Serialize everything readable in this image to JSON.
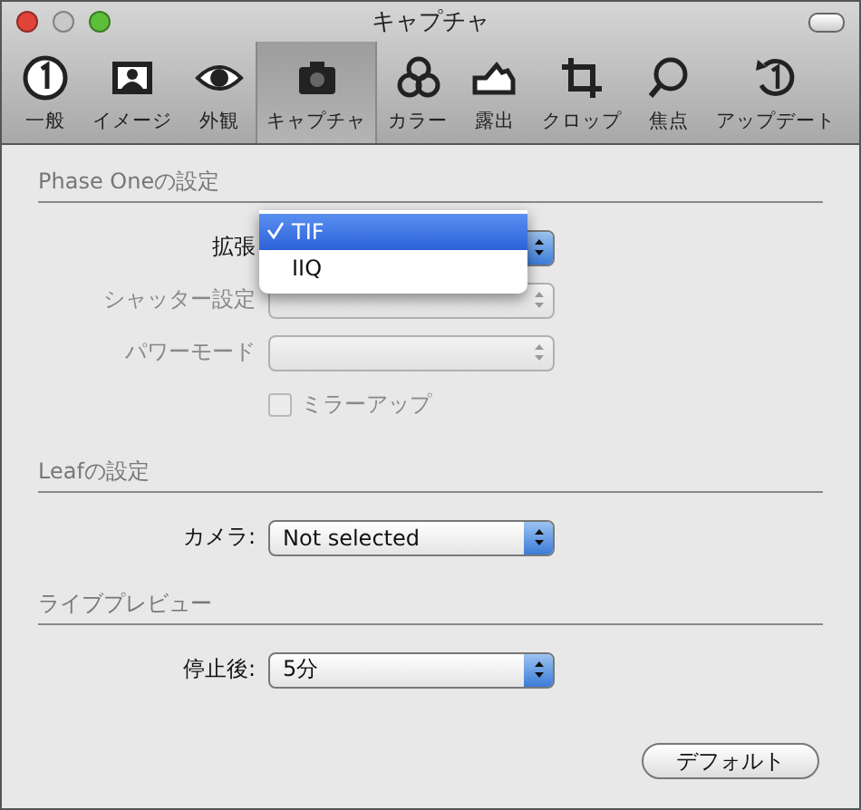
{
  "window": {
    "title": "キャプチャ"
  },
  "toolbar": [
    {
      "label": "一般",
      "selected": false
    },
    {
      "label": "イメージ",
      "selected": false
    },
    {
      "label": "外観",
      "selected": false
    },
    {
      "label": "キャプチャ",
      "selected": true
    },
    {
      "label": "カラー",
      "selected": false
    },
    {
      "label": "露出",
      "selected": false
    },
    {
      "label": "クロップ",
      "selected": false
    },
    {
      "label": "焦点",
      "selected": false
    },
    {
      "label": "アップデート",
      "selected": false
    }
  ],
  "sections": [
    {
      "title": "Phase Oneの設定",
      "rows": [
        {
          "kind": "popup",
          "label": "拡張",
          "disabled": false,
          "open": true,
          "menu": [
            {
              "label": "TIF",
              "selected": true
            },
            {
              "label": "IIQ",
              "selected": false
            }
          ]
        },
        {
          "kind": "popup",
          "label": "シャッター設定",
          "disabled": true
        },
        {
          "kind": "popup",
          "label": "パワーモード",
          "disabled": true
        },
        {
          "kind": "checkbox",
          "label": "ミラーアップ",
          "disabled": true,
          "checked": false
        }
      ]
    },
    {
      "title": "Leafの設定",
      "rows": [
        {
          "kind": "popup",
          "label": "カメラ:",
          "value": "Not selected",
          "disabled": false
        }
      ]
    },
    {
      "title": "ライブプレビュー",
      "rows": [
        {
          "kind": "popup",
          "label": "停止後:",
          "value": "5分",
          "disabled": false
        }
      ]
    }
  ],
  "default_button": "デフォルト"
}
